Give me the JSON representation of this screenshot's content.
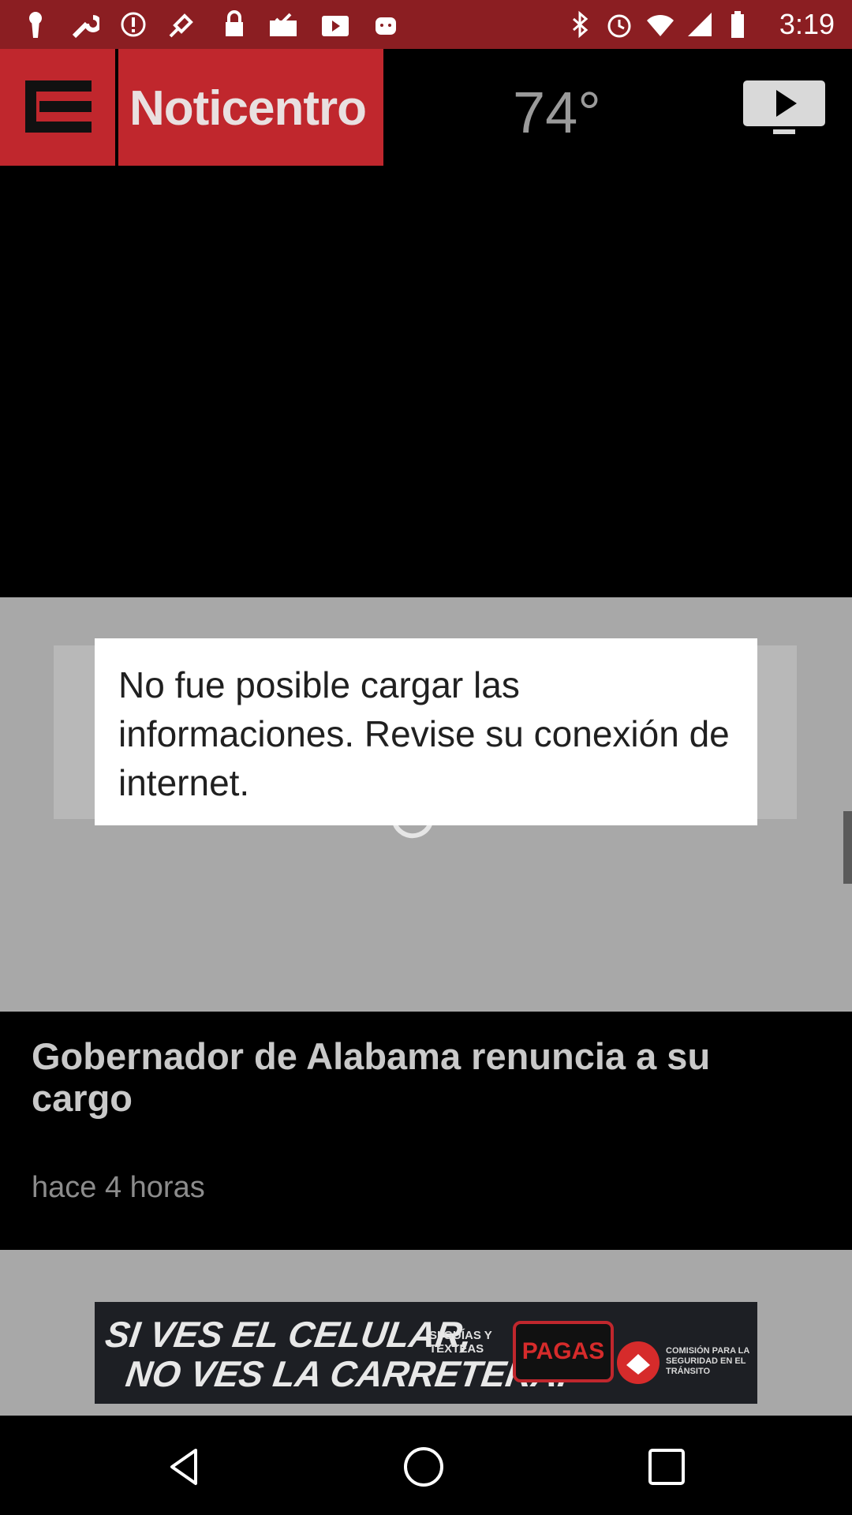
{
  "status_bar": {
    "time": "3:19",
    "icons": [
      "keyhole-icon",
      "wrench-icon",
      "alert-icon",
      "fake-gps-icon",
      "lock-icon",
      "mail-check-icon",
      "play-store-icon",
      "android-icon",
      "bluetooth-icon",
      "alarm-icon",
      "wifi-icon",
      "signal-icon",
      "battery-icon"
    ],
    "color": "#8b1e22"
  },
  "header": {
    "brand": "Noticentro",
    "temperature": "74°",
    "brand_color": "#c0272d"
  },
  "dialog": {
    "message": "No fue posible cargar las informaciones. Revise su conexión de internet."
  },
  "news": {
    "title": "Gobernador de Alabama renuncia a su cargo",
    "time_ago": "hace 4 horas"
  },
  "ad": {
    "line1": "SI VES EL CELULAR,",
    "line2": "NO VES LA CARRETERA.",
    "sub": "SI GUÍAS Y TEXTEAS",
    "pagas": "PAGAS",
    "org": "COMISIÓN PARA LA SEGURIDAD EN EL TRÁNSITO"
  },
  "navbar": {
    "buttons": [
      "back-icon",
      "home-icon",
      "recents-icon"
    ]
  }
}
